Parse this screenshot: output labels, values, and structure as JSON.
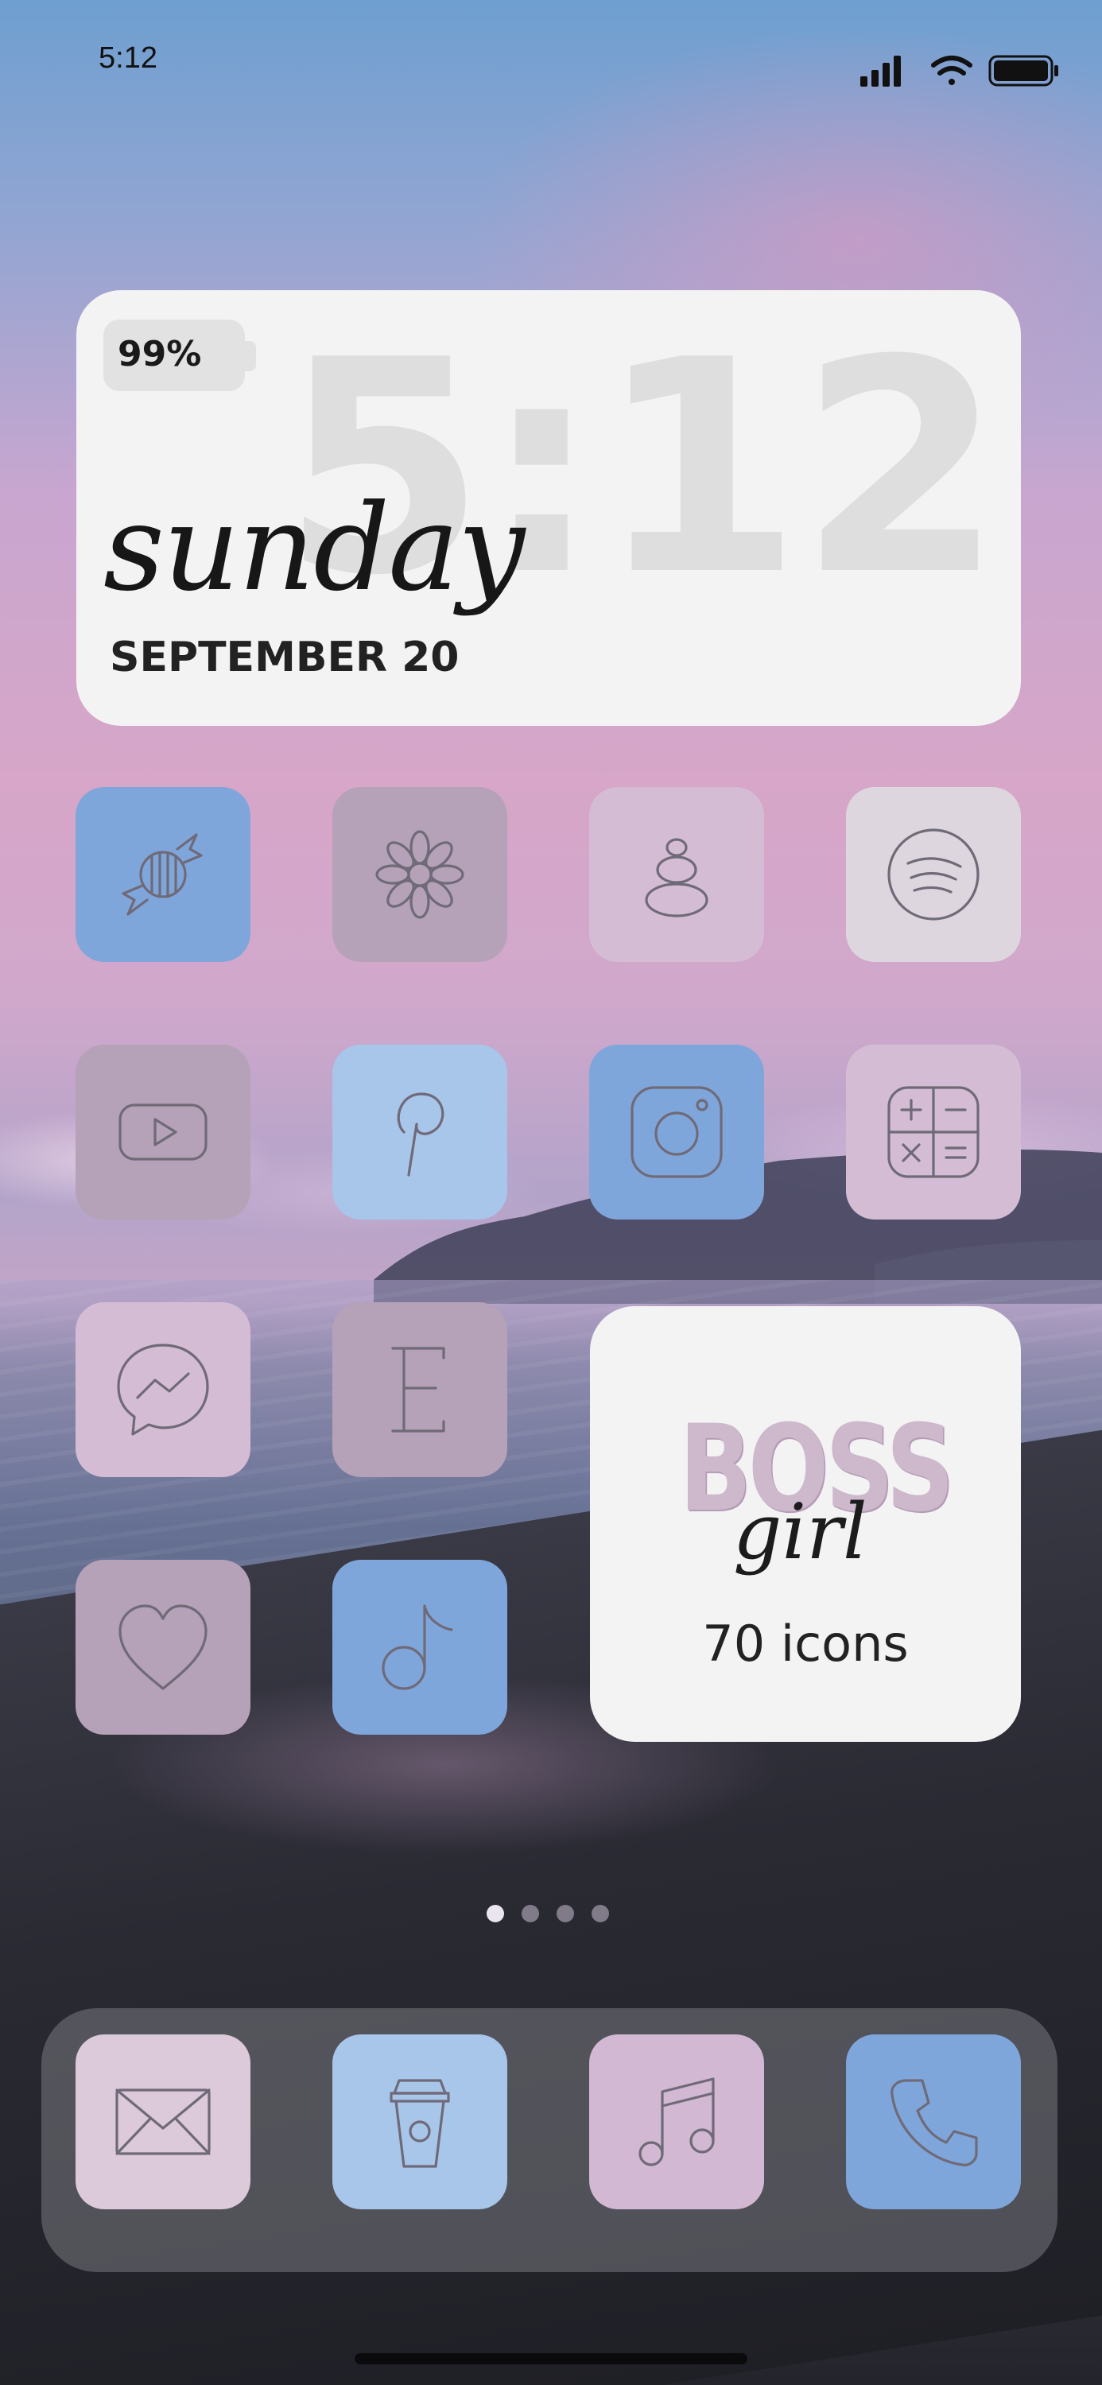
{
  "status_bar": {
    "time": "5:12"
  },
  "clock_widget": {
    "battery": "99%",
    "time": "5:12",
    "day": "sunday",
    "date": "SEPTEMBER 20"
  },
  "apps": {
    "candy": "Candy",
    "flower": "Flower",
    "stones": "Stones",
    "spotify": "Spotify",
    "youtube": "YouTube",
    "pinterest": "Pinterest",
    "instagram": "Instagram",
    "calculator": "Calculator",
    "messenger": "Messenger",
    "etsy": "Etsy",
    "health": "Health",
    "tiktok": "TikTok"
  },
  "promo_widget": {
    "boss": "BOSS",
    "girl": "girl",
    "count": "70 icons"
  },
  "page_indicator": {
    "pages": 4,
    "current": 1
  },
  "dock": {
    "mail": "Mail",
    "coffee": "Coffee",
    "music": "Music",
    "phone": "Phone"
  },
  "colors": {
    "icon_blue": "#7fa6db",
    "icon_light_blue": "#a8c5ea",
    "icon_mauve": "#b5a2b8",
    "icon_pink": "#d5bcd5",
    "widget_bg": "#f3f3f3"
  }
}
